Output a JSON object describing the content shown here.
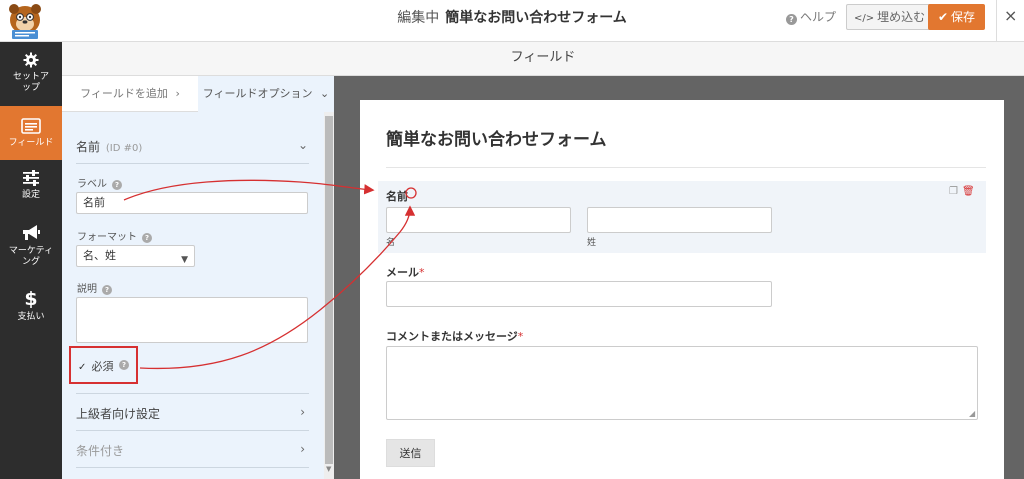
{
  "header": {
    "mode_label": "編集中",
    "form_name": "簡単なお問い合わせフォーム",
    "help_label": "ヘルプ",
    "embed_label": "埋め込む",
    "save_label": "保存",
    "close_symbol": "×"
  },
  "nav": {
    "items": [
      {
        "label": "セットアップ",
        "icon": "gear-icon"
      },
      {
        "label": "フィールド",
        "icon": "fields-icon",
        "active": true
      },
      {
        "label": "設定",
        "icon": "sliders-icon"
      },
      {
        "label": "マーケティング",
        "icon": "megaphone-icon"
      },
      {
        "label": "支払い",
        "icon": "dollar-icon"
      }
    ]
  },
  "fieldbar": {
    "title": "フィールド"
  },
  "sidebar": {
    "tab_add": "フィールドを追加",
    "tab_add_chevron": "›",
    "tab_options": "フィールドオプション",
    "tab_options_chevron": "⌄",
    "field_name": "名前",
    "field_id": "(ID #0)",
    "label_label": "ラベル",
    "label_value": "名前",
    "format_label": "フォーマット",
    "format_value": "名、姓",
    "description_label": "説明",
    "description_value": "",
    "required_label": "必須",
    "required_checked": true,
    "advanced_label": "上級者向け設定",
    "conditional_label": "条件付き",
    "help_glyph": "?"
  },
  "preview": {
    "form_title": "簡単なお問い合わせフォーム",
    "name_label": "名前",
    "first_sublabel": "名",
    "last_sublabel": "姓",
    "email_label": "メール",
    "email_required_mark": "*",
    "comment_label": "コメントまたはメッセージ",
    "comment_required_mark": "*",
    "submit_label": "送信"
  },
  "colors": {
    "accent": "#e27730",
    "annotation": "#d63031",
    "nav_bg": "#2d2d2d",
    "sidebar_bg": "#ebf3fc"
  }
}
